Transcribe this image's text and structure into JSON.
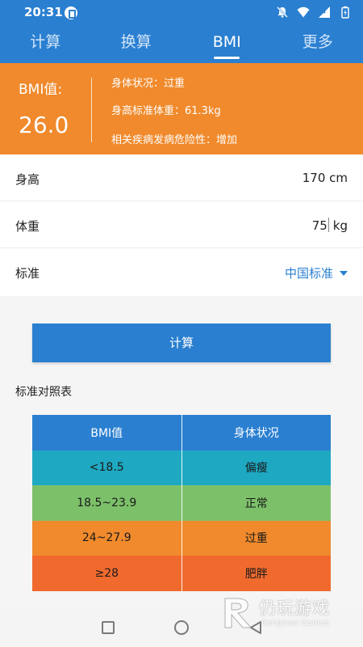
{
  "status_bar": {
    "time": "20:31",
    "icons": [
      "app-notification-icon",
      "mute-icon",
      "wifi-icon",
      "signal-icon",
      "battery-icon"
    ]
  },
  "tabs": [
    {
      "label": "计算",
      "active": false
    },
    {
      "label": "换算",
      "active": false
    },
    {
      "label": "BMI",
      "active": true
    },
    {
      "label": "更多",
      "active": false
    }
  ],
  "result": {
    "bmi_label": "BMI值:",
    "bmi_value": "26.0",
    "body_status": "身体状况：过重",
    "standard_weight": "身高标准体重：61.3kg",
    "disease_risk": "相关疾病发病危险性：增加"
  },
  "form": {
    "height_label": "身高",
    "height_value": "170 cm",
    "weight_label": "体重",
    "weight_value": "75",
    "weight_unit": "kg",
    "standard_label": "标准",
    "standard_value": "中国标准"
  },
  "calc_button_label": "计算",
  "table": {
    "title": "标准对照表",
    "headers": [
      "BMI值",
      "身体状况"
    ],
    "rows": [
      {
        "range": "<18.5",
        "status": "偏瘦",
        "color": "#1ea8c2"
      },
      {
        "range": "18.5~23.9",
        "status": "正常",
        "color": "#7cc16a"
      },
      {
        "range": "24~27.9",
        "status": "过重",
        "color": "#f08a2c"
      },
      {
        "range": "≥28",
        "status": "肥胖",
        "color": "#f06a2e"
      }
    ]
  },
  "watermark": {
    "text_cn": "仍玩游戏",
    "text_en": "Rengwan Games"
  },
  "colors": {
    "primary": "#2a7fd0",
    "accent_orange": "#f08a2c"
  }
}
